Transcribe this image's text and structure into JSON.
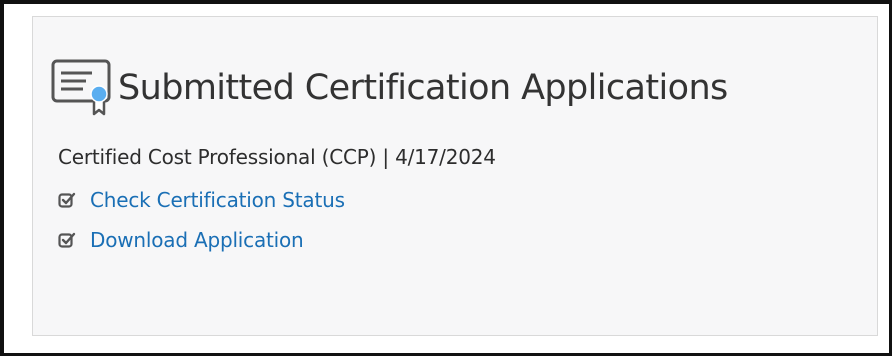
{
  "section": {
    "title": "Submitted Certification Applications",
    "icon": "certificate-icon"
  },
  "application": {
    "certification": "Certified Cost Professional (CCP)",
    "separator": "|",
    "date": "4/17/2024",
    "summary": "Certified Cost Professional (CCP) | 4/17/2024"
  },
  "actions": [
    {
      "label": "Check Certification Status",
      "icon": "checkbox-check-icon"
    },
    {
      "label": "Download Application",
      "icon": "checkbox-check-icon"
    }
  ],
  "colors": {
    "link": "#1a6fb5",
    "badge": "#5aaef0",
    "text": "#333333",
    "card_bg": "#f7f7f8"
  }
}
